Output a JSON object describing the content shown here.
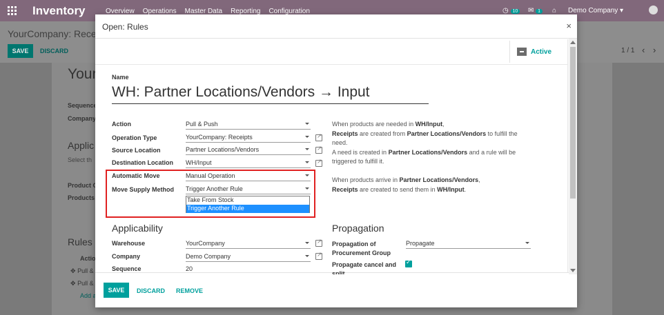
{
  "app": {
    "brand": "Inventory",
    "menu": [
      "Overview",
      "Operations",
      "Master Data",
      "Reporting",
      "Configuration"
    ],
    "activity_count": "10",
    "message_count": "1",
    "company": "Demo Company"
  },
  "background": {
    "breadcrumb": "YourCompany: Receive",
    "save_label": "SAVE",
    "discard_label": "DISCARD",
    "pager": "1 / 1",
    "title_fragment": "Your",
    "sequence_fragment": "Sequence",
    "company_fragment": "Company",
    "applic_fragment": "Applic",
    "select_fragment": "Select th",
    "product_c_fragment": "Product C",
    "products_fragment": "Products",
    "rules_fragment": "Rules",
    "action_fragment": "Actio",
    "pull1_fragment": "Pull &",
    "pull2_fragment": "Pull &",
    "add_fragment": "Add a"
  },
  "modal": {
    "title": "Open: Rules",
    "active_label": "Active",
    "name_label": "Name",
    "name_value": "WH: Partner Locations/Vendors → Input",
    "fields": {
      "action": {
        "label": "Action",
        "value": "Pull & Push"
      },
      "operation_type": {
        "label": "Operation Type",
        "value": "YourCompany: Receipts"
      },
      "source_location": {
        "label": "Source Location",
        "value": "Partner Locations/Vendors"
      },
      "destination_location": {
        "label": "Destination Location",
        "value": "WH/Input"
      },
      "automatic_move": {
        "label": "Automatic Move",
        "value": "Manual Operation"
      },
      "move_supply_method": {
        "label": "Move Supply Method",
        "value": "Trigger Another Rule"
      }
    },
    "dropdown_options": [
      "Take From Stock",
      "Trigger Another Rule"
    ],
    "help": {
      "p1_a": "When products are needed in ",
      "p1_b": "WH/Input",
      "p1_c": ",",
      "p1_d": "Receipts",
      "p1_e": " are created from ",
      "p1_f": "Partner Locations/Vendors",
      "p1_g": " to fulfill the need.",
      "p2_a": "A need is created in ",
      "p2_b": "Partner Locations/Vendors",
      "p2_c": " and a rule will be triggered to fulfill it.",
      "p3_a": "When products arrive in ",
      "p3_b": "Partner Locations/Vendors",
      "p3_c": ",",
      "p3_d": "Receipts",
      "p3_e": " are created to send them in ",
      "p3_f": "WH/Input",
      "p3_g": "."
    },
    "applicability": {
      "title": "Applicability",
      "warehouse": {
        "label": "Warehouse",
        "value": "YourCompany"
      },
      "company": {
        "label": "Company",
        "value": "Demo Company"
      },
      "sequence": {
        "label": "Sequence",
        "value": "20"
      }
    },
    "propagation": {
      "title": "Propagation",
      "group_label_1": "Propagation of",
      "group_label_2": "Procurement Group",
      "group_value": "Propagate",
      "cancel_label_1": "Propagate cancel and",
      "cancel_label_2": "split"
    },
    "footer": {
      "save": "SAVE",
      "discard": "DISCARD",
      "remove": "REMOVE"
    }
  },
  "colors": {
    "brand": "#875a7b",
    "accent": "#00a09d",
    "highlight": "#e02020",
    "selected_option": "#1e90ff"
  }
}
